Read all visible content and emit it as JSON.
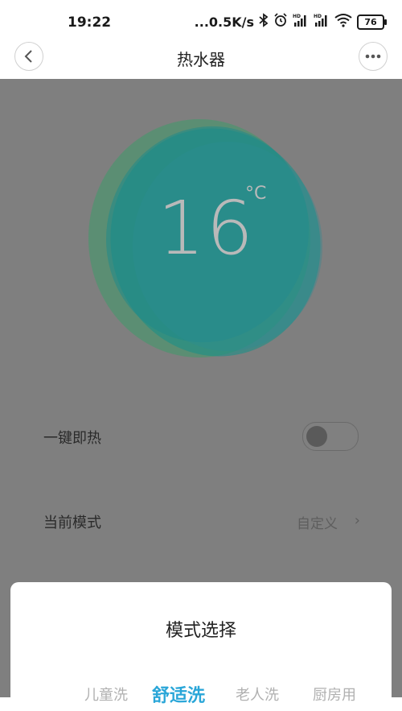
{
  "status_bar": {
    "time": "19:22",
    "network_speed": "...0.5K/s",
    "battery_level": "76",
    "icons": [
      "bluetooth-icon",
      "alarm-icon",
      "signal-hd-icon",
      "signal-hd-icon",
      "wifi-icon"
    ]
  },
  "header": {
    "title": "热水器",
    "back_icon": "chevron-left-icon",
    "more_icon": "more-dots-icon"
  },
  "thermostat": {
    "temperature": "16",
    "unit": "°C"
  },
  "settings": {
    "quick_heat_label": "一键即热",
    "quick_heat_on": false,
    "current_mode_label": "当前模式",
    "current_mode_value": "自定义",
    "chevron": "›"
  },
  "mode_sheet": {
    "title": "模式选择",
    "options": [
      "儿童洗",
      "舒适洗",
      "老人洗",
      "厨房用"
    ],
    "selected": "舒适洗"
  },
  "colors": {
    "accent": "#2aa6d8",
    "overlay": "#7f7f7f",
    "blob_teal": "#1b8f87",
    "blob_green": "#3e9a6a"
  }
}
